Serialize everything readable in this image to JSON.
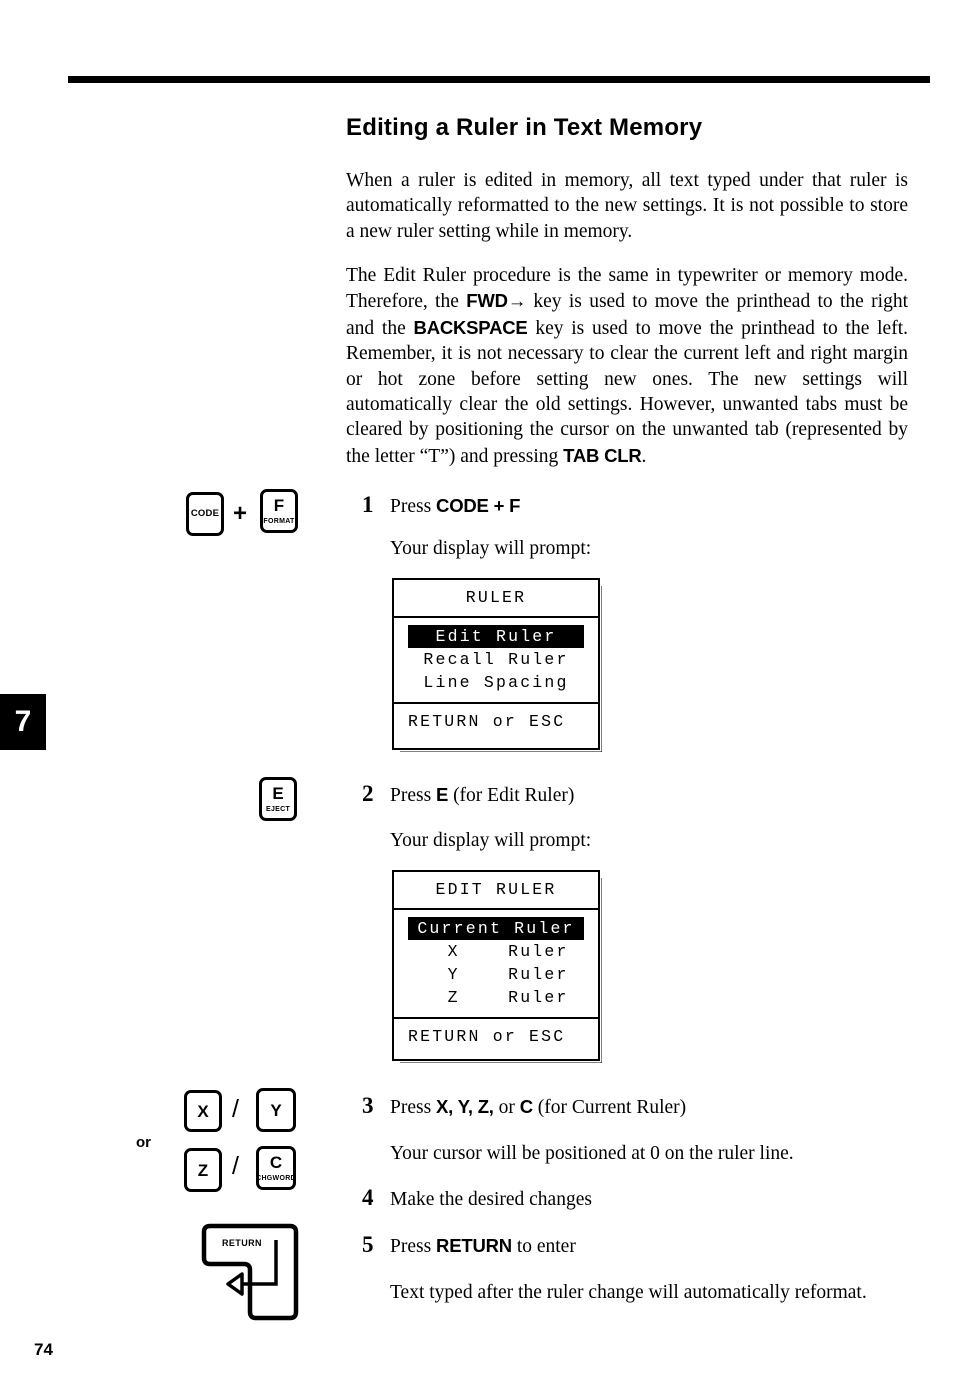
{
  "page": {
    "number": "74",
    "chapter_tab": "7"
  },
  "heading": "Editing a Ruler in Text Memory",
  "paragraphs": {
    "p1": "When a ruler is edited in memory, all text typed under that ruler is automatically reformatted to the new settings. It is not possible to store a new ruler setting while in memory.",
    "p2_a": "The Edit Ruler procedure is the same in typewriter or memory mode. Therefore, the ",
    "p2_fwd": "FWD→",
    "p2_b": " key is used to move the printhead to the right and the ",
    "p2_backspace": "BACKSPACE",
    "p2_c": " key is used to move the printhead to the left. Remember, it is not necessary to clear the current left and right margin or hot zone before setting new ones. The new settings will automatically clear the old settings. However, unwanted tabs must be cleared by positioning the cursor on the unwanted tab (represented by the letter “T”) and pressing ",
    "p2_tabclr": "TAB CLR",
    "p2_d": "."
  },
  "steps": [
    {
      "number": "1",
      "text_a": "Press ",
      "text_bold": "CODE + F",
      "text_b": "",
      "follow": "Your display will prompt:"
    },
    {
      "number": "2",
      "text_a": "Press ",
      "text_bold": "E",
      "text_b": " (for Edit Ruler)",
      "follow": "Your display will prompt:"
    },
    {
      "number": "3",
      "text_a": "Press ",
      "text_bold": "X, Y, Z,",
      "text_b": " or ",
      "text_bold2": "C",
      "text_c": " (for Current Ruler)",
      "follow": "Your cursor will be positioned at 0 on the ruler line."
    },
    {
      "number": "4",
      "text_a": "Make the desired changes",
      "text_bold": "",
      "text_b": "",
      "follow": ""
    },
    {
      "number": "5",
      "text_a": "Press ",
      "text_bold": "RETURN",
      "text_b": " to enter",
      "follow": "Text typed after the ruler change will automatically reformat."
    }
  ],
  "dialogs": [
    {
      "title": "RULER",
      "items": [
        {
          "label": "Edit Ruler",
          "selected": true
        },
        {
          "label": "Recall Ruler",
          "selected": false
        },
        {
          "label": "Line Spacing",
          "selected": false
        }
      ],
      "footer": "RETURN or ESC"
    },
    {
      "title": "EDIT RULER",
      "items": [
        {
          "label": "Current Ruler",
          "selected": true
        },
        {
          "label": "  X    Ruler",
          "selected": false
        },
        {
          "label": "  Y    Ruler",
          "selected": false
        },
        {
          "label": "  Z    Ruler",
          "selected": false
        }
      ],
      "footer": "RETURN or ESC"
    }
  ],
  "keys": {
    "code": {
      "main": "CODE",
      "sub": ""
    },
    "f": {
      "main": "F",
      "sub": "FORMAT"
    },
    "e": {
      "main": "E",
      "sub": "EJECT"
    },
    "x": {
      "main": "X",
      "sub": ""
    },
    "y": {
      "main": "Y",
      "sub": ""
    },
    "z": {
      "main": "Z",
      "sub": ""
    },
    "c": {
      "main": "C",
      "sub": "CHGWORD"
    },
    "return": {
      "main": "RETURN"
    },
    "plus": "+",
    "slash": "/",
    "or": "or"
  }
}
